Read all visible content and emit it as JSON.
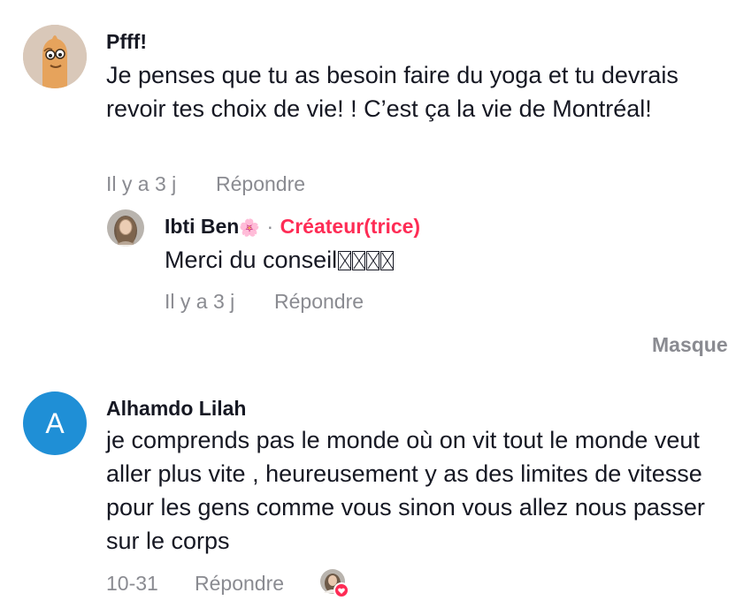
{
  "comments": [
    {
      "username": "Pfff!",
      "text": "Je penses que tu as besoin faire du yoga et tu devrais revoir tes choix de vie! ! C’est ça la vie de Montréal!",
      "time": "Il y a 3 j",
      "reply_label": "Répondre",
      "avatar_icon": "cartoon-face-avatar-icon",
      "reply": {
        "username": "Ibti Ben",
        "username_emoji": "🌸",
        "separator": "·",
        "badge": "Créateur(trice)",
        "text": "Merci du conseil",
        "time": "Il y a 3 j",
        "reply_label": "Répondre"
      }
    },
    {
      "username": "Alhamdo Lilah",
      "avatar_letter": "A",
      "text": "je comprends pas le monde où on vit tout le monde veut aller plus vite , heureusement y as des limites de vitesse pour les gens comme vous sinon vous allez nous passer sur le corps",
      "time": "10-31",
      "reply_label": "Répondre",
      "liked_by_creator_icon": "creator-like-icon"
    }
  ],
  "hide_label": "Masque",
  "colors": {
    "accent": "#fe2c55",
    "muted": "#8a8b91",
    "letter_avatar": "#1f8fd6",
    "text": "#161823"
  }
}
